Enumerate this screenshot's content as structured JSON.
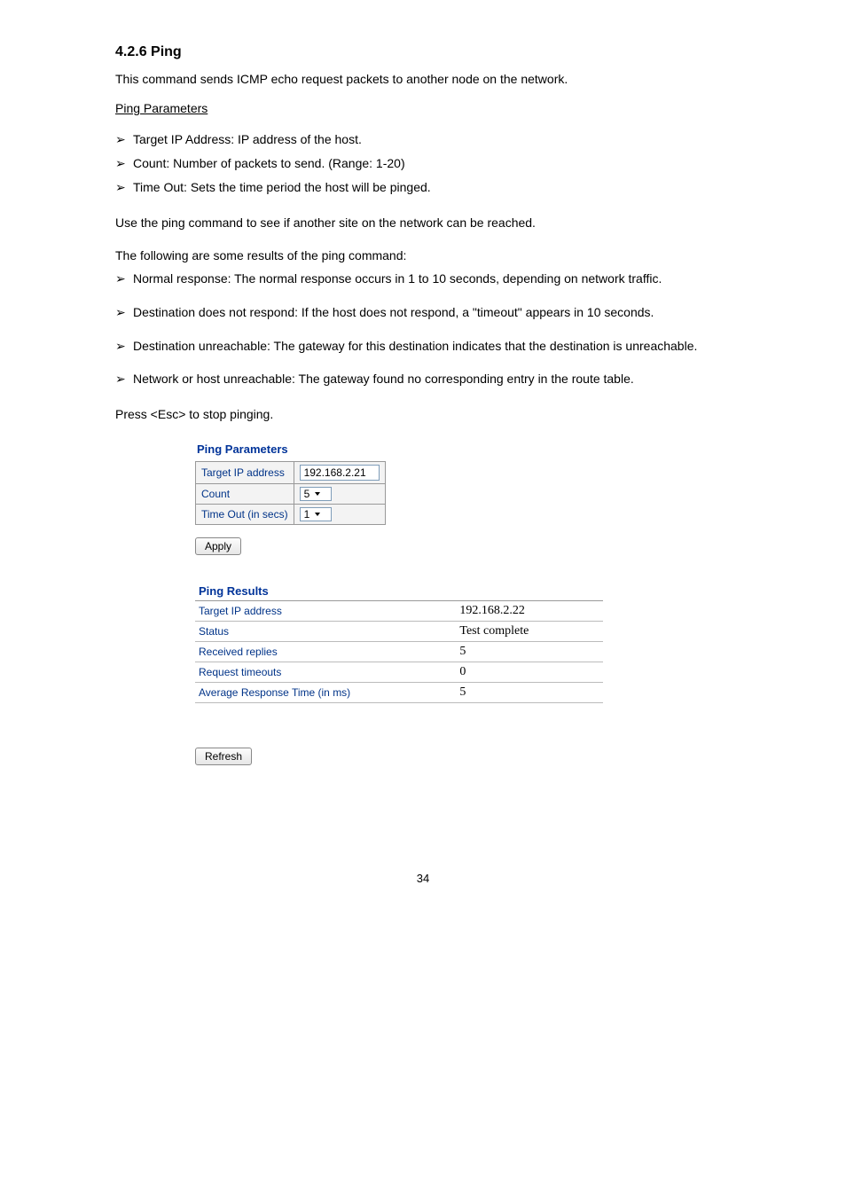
{
  "heading": "4.2.6 Ping",
  "intro": "This command sends ICMP echo request packets to another node on the network.",
  "subheading": "Ping Parameters",
  "bullets1": [
    "Target IP Address: IP address of the host.",
    "Count: Number of packets to send. (Range: 1-20)",
    "Time Out: Sets the time period the host will be pinged."
  ],
  "para1": "Use the ping command to see if another site on the network can be reached.",
  "para2": "The following are some results of the ping command:",
  "bullets2": [
    "Normal response: The normal response occurs in 1 to 10 seconds, depending on network traffic.",
    "Destination does not respond: If the host does not respond, a \"timeout\" appears in 10 seconds.",
    "Destination unreachable: The gateway for this destination indicates that the destination is unreachable.",
    "Network or host unreachable: The gateway found no corresponding entry in the route table."
  ],
  "escline": "Press <Esc> to stop pinging.",
  "params_title": "Ping Parameters",
  "params": {
    "target_label": "Target IP address",
    "target_value": "192.168.2.21",
    "count_label": "Count",
    "count_value": "5",
    "timeout_label": "Time Out (in secs)",
    "timeout_value": "1"
  },
  "apply_label": "Apply",
  "results_title": "Ping Results",
  "results": {
    "target_label": "Target IP address",
    "target_value": "192.168.2.22",
    "status_label": "Status",
    "status_value": "Test complete",
    "received_label": "Received replies",
    "received_value": "5",
    "timeouts_label": "Request timeouts",
    "timeouts_value": "0",
    "avg_label": "Average Response Time (in ms)",
    "avg_value": "5"
  },
  "refresh_label": "Refresh",
  "page_number": "34"
}
